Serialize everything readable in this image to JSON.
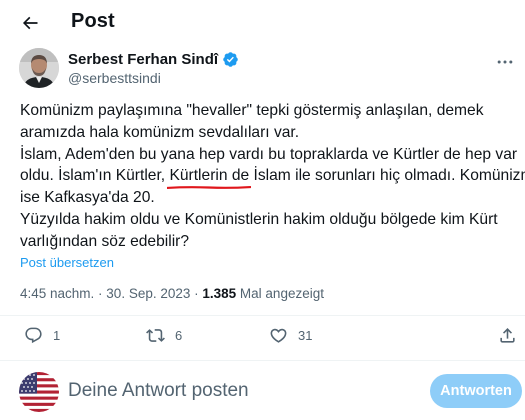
{
  "header": {
    "title": "Post"
  },
  "author": {
    "display_name": "Serbest Ferhan Sindî",
    "handle": "@serbesttsindi"
  },
  "tweet": {
    "lines": [
      "Komünizm paylaşımına \"hevaller\" tepki göstermiş anlaşılan, demek",
      "aramızda hala komünizm sevdalıları var.",
      "İslam, Adem'den bu yana hep vardı bu topraklarda ve Kürtler de hep var"
    ],
    "line4_before": "oldu. İslam'ın Kürtler, ",
    "line4_underlined": "Kürtlerin de İslam ile sorunları hiç olmadı",
    "line4_after": ". Komünizm",
    "lines_end": [
      "ise Kafkasya'da 20.",
      "Yüzyılda hakim oldu ve Komünistlerin hakim olduğu bölgede kim Kürt",
      "varlığından söz edebilir?"
    ]
  },
  "translate_label": "Post übersetzen",
  "meta": {
    "time": "4:45 nachm.",
    "separator": " · ",
    "date": "30. Sep. 2023",
    "views_count": "1.385",
    "views_label": " Mal angezeigt"
  },
  "actions": {
    "replies": "1",
    "reposts": "6",
    "likes": "31"
  },
  "reply": {
    "placeholder": "Deine Antwort posten",
    "button_label": "Antworten"
  },
  "colors": {
    "accent": "#1d9bf0",
    "reply_button_disabled": "#8ecdf8",
    "secondary_text": "#536471",
    "underline_mark": "#e0161b"
  },
  "icons": {
    "back": "arrow-left-icon",
    "verified": "verified-badge-icon",
    "more": "more-icon",
    "reply": "reply-icon",
    "repost": "repost-icon",
    "like": "heart-icon",
    "flag": "us-flag-icon"
  }
}
